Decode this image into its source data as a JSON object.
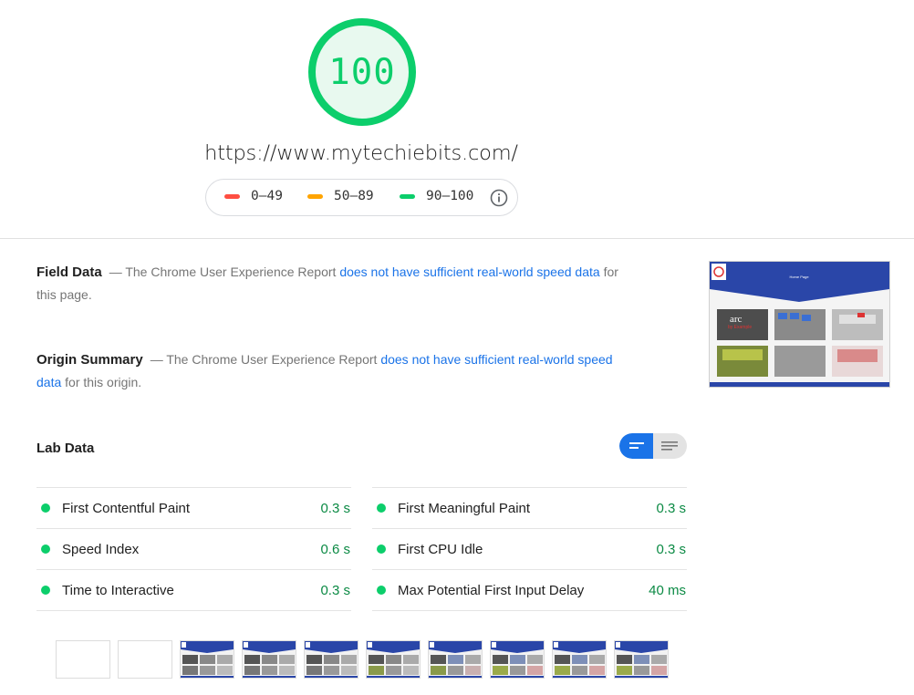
{
  "score": {
    "value": "100",
    "color": "#0cce6b"
  },
  "page_url": "https://www.mytechiebits.com/",
  "legend": {
    "items": [
      {
        "label": "0–49",
        "color": "#ff4e42"
      },
      {
        "label": "50–89",
        "color": "#ffa400"
      },
      {
        "label": "90–100",
        "color": "#0cce6b"
      }
    ],
    "info_icon": "info-icon"
  },
  "field_data": {
    "title": "Field Data",
    "prefix": "— The Chrome User Experience Report ",
    "link": "does not have sufficient real-world speed data",
    "suffix": " for this page."
  },
  "origin_summary": {
    "title": "Origin Summary",
    "prefix": "— The Chrome User Experience Report ",
    "link": "does not have sufficient real-world speed data",
    "suffix": " for this origin."
  },
  "lab_data": {
    "title": "Lab Data",
    "toggle": {
      "active": "bar-view-icon",
      "inactive": "list-view-icon"
    },
    "metrics_left": [
      {
        "label": "First Contentful Paint",
        "value": "0.3 s"
      },
      {
        "label": "Speed Index",
        "value": "0.6 s"
      },
      {
        "label": "Time to Interactive",
        "value": "0.3 s"
      }
    ],
    "metrics_right": [
      {
        "label": "First Meaningful Paint",
        "value": "0.3 s"
      },
      {
        "label": "First CPU Idle",
        "value": "0.3 s"
      },
      {
        "label": "Max Potential First Input Delay",
        "value": "40 ms"
      }
    ]
  },
  "screenshot": {
    "heading": "Home Page",
    "image_text": "arc",
    "image_subtext": "by Example"
  },
  "filmstrip": {
    "frame_count": 10,
    "blank_frames": 2
  },
  "colors": {
    "good": "#0cce6b",
    "good_text": "#0b8a44",
    "link": "#1a73e8",
    "site_blue": "#2a46a8"
  }
}
